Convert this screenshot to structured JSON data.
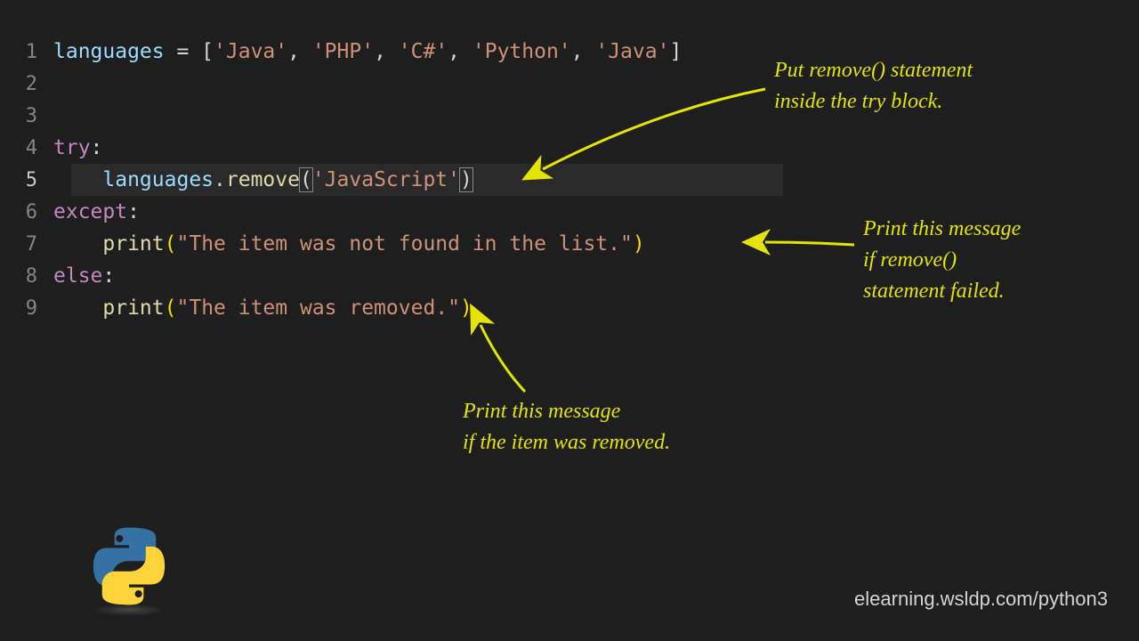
{
  "code": {
    "lines": [
      "1",
      "2",
      "3",
      "4",
      "5",
      "6",
      "7",
      "8",
      "9"
    ],
    "active_line": 5,
    "l1": {
      "var": "languages",
      "op": " = ",
      "lb": "[",
      "s1": "'Java'",
      "c1": ", ",
      "s2": "'PHP'",
      "c2": ", ",
      "s3": "'C#'",
      "c3": ", ",
      "s4": "'Python'",
      "c4": ", ",
      "s5": "'Java'",
      "rb": "]"
    },
    "l4": {
      "kw": "try",
      "colon": ":"
    },
    "l5": {
      "indent": "    ",
      "var": "languages",
      "dot": ".",
      "fn": "remove",
      "lp": "(",
      "arg": "'JavaScript'",
      "rp": ")"
    },
    "l6": {
      "kw": "except",
      "colon": ":"
    },
    "l7": {
      "indent": "    ",
      "fn": "print",
      "lp": "(",
      "arg": "\"The item was not found in the list.\"",
      "rp": ")"
    },
    "l8": {
      "kw": "else",
      "colon": ":"
    },
    "l9": {
      "indent": "    ",
      "fn": "print",
      "lp": "(",
      "arg": "\"The item was removed.\"",
      "rp": ")"
    }
  },
  "annotations": {
    "a1_l1": "Put remove() statement",
    "a1_l2": "inside the try block.",
    "a2_l1": "Print this message",
    "a2_l2": "if remove()",
    "a2_l3": "statement failed.",
    "a3_l1": "Print this message",
    "a3_l2": "if the item was removed."
  },
  "footer": {
    "url": "elearning.wsldp.com/python3"
  },
  "colors": {
    "accent": "#e4e400"
  }
}
